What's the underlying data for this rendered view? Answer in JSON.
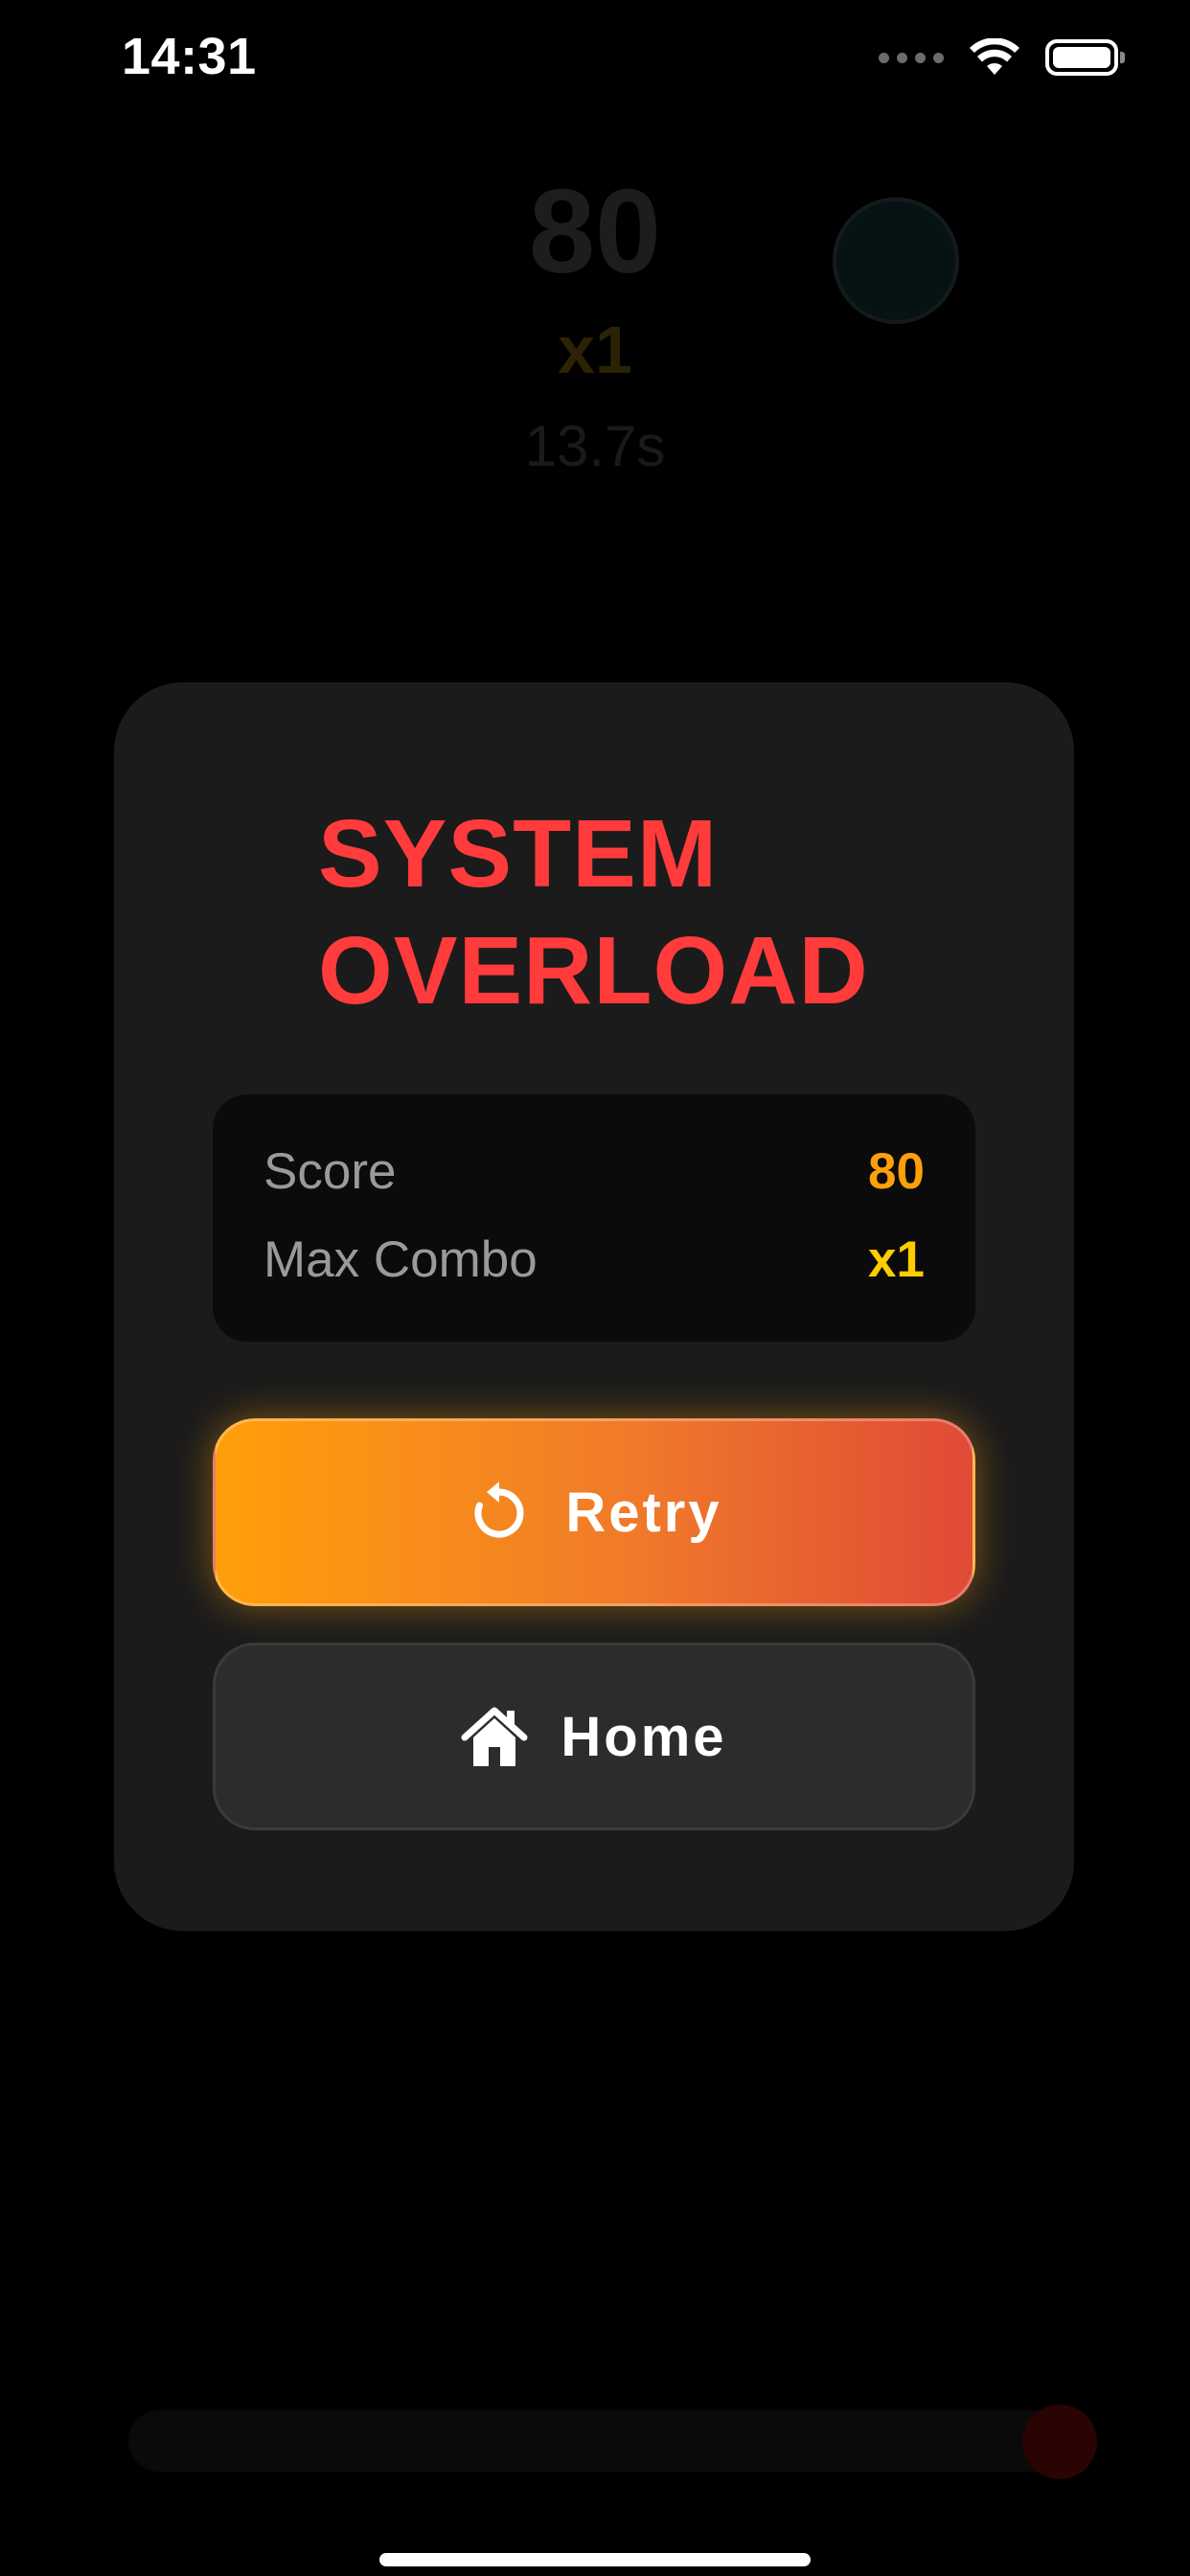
{
  "status_bar": {
    "time": "14:31",
    "icons": [
      "signal-dots-icon",
      "wifi-icon",
      "battery-icon"
    ]
  },
  "hud": {
    "score": "80",
    "combo": "x1",
    "timer": "13.7s"
  },
  "game_over": {
    "title_line1": "SYSTEM",
    "title_line2": "OVERLOAD",
    "stats": {
      "score_label": "Score",
      "score_value": "80",
      "combo_label": "Max Combo",
      "combo_value": "x1"
    },
    "retry_label": "Retry",
    "home_label": "Home"
  },
  "colors": {
    "title": "#ff3b3b",
    "score_accent": "#ff9f0a",
    "combo_accent": "#ffcc00",
    "retry_gradient_start": "#ff9f0a",
    "retry_gradient_end": "#e04a36",
    "modal_bg": "#1b1b1b"
  }
}
